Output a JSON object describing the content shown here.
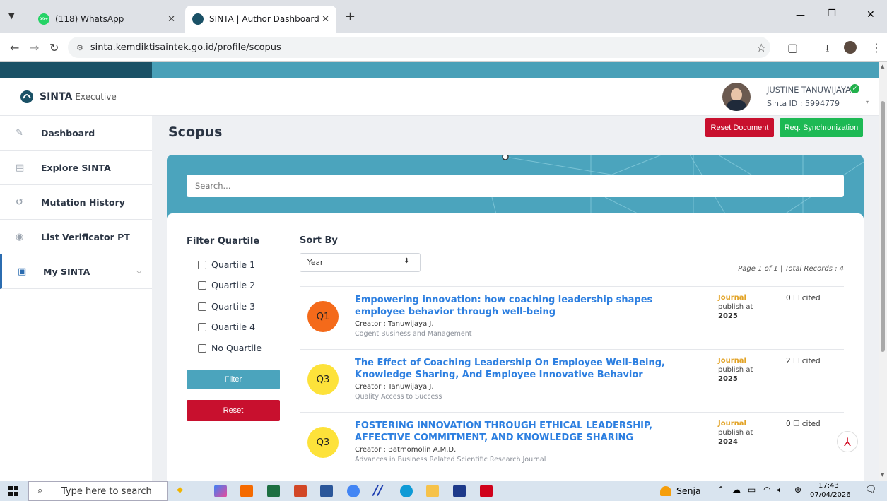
{
  "browser": {
    "tabs": [
      {
        "label": "(118) WhatsApp",
        "badge": "99+"
      },
      {
        "label": "SINTA | Author Dashboard"
      }
    ],
    "new_tab": "+",
    "url": "sinta.kemdiktisaintek.go.id/profile/scopus"
  },
  "sidebar": {
    "brand_name": "SINTA",
    "brand_sub": "Executive",
    "items": [
      {
        "label": "Dashboard",
        "icon": "pencil-icon"
      },
      {
        "label": "Explore SINTA",
        "icon": "document-icon"
      },
      {
        "label": "Mutation History",
        "icon": "history-icon"
      },
      {
        "label": "List Verificator PT",
        "icon": "user-circle-icon"
      },
      {
        "label": "My SINTA",
        "icon": "id-card-icon"
      }
    ]
  },
  "header": {
    "user_name": "JUSTINE TANUWIJAYA",
    "sinta_id": "Sinta ID : 5994779"
  },
  "page_title": "Scopus",
  "buttons": {
    "reset_document": "Reset Document",
    "req_sync": "Req. Synchronization",
    "filter": "Filter",
    "reset": "Reset"
  },
  "search": {
    "placeholder": "Search..."
  },
  "filter": {
    "title": "Filter Quartile",
    "options": [
      "Quartile 1",
      "Quartile 2",
      "Quartile 3",
      "Quartile 4",
      "No Quartile"
    ]
  },
  "sort": {
    "label": "Sort By",
    "selected": "Year"
  },
  "page_info": "Page 1 of 1 | Total Records : 4",
  "records": [
    {
      "quartile": "Q1",
      "color": "#f46a1a",
      "title": "Empowering innovation: how coaching leadership shapes employee behavior through well-being",
      "creator": "Creator : Tanuwijaya J.",
      "journal": "Cogent Business and Management",
      "type": "Journal",
      "publish_label": "publish at",
      "year": "2025",
      "cited": "0 ☐ cited"
    },
    {
      "quartile": "Q3",
      "color": "#fde23a",
      "title": "The Effect of Coaching Leadership On Employee Well-Being, Knowledge Sharing, And Employee Innovative Behavior",
      "creator": "Creator : Tanuwijaya J.",
      "journal": "Quality Access to Success",
      "type": "Journal",
      "publish_label": "publish at",
      "year": "2025",
      "cited": "2 ☐ cited"
    },
    {
      "quartile": "Q3",
      "color": "#fde23a",
      "title": "FOSTERING INNOVATION THROUGH ETHICAL LEADERSHIP, AFFECTIVE COMMITMENT, AND KNOWLEDGE SHARING",
      "creator": "Creator : Batmomolin A.M.D.",
      "journal": "Advances in Business Related Scientific Research Journal",
      "type": "Journal",
      "publish_label": "publish at",
      "year": "2024",
      "cited": "0 ☐ cited"
    }
  ],
  "taskbar": {
    "search_placeholder": "Type here to search",
    "weather": "Senja",
    "time": "17:43",
    "date": "07/04/2026"
  },
  "colors": {
    "accent_teal": "#49a0b8",
    "danger": "#c8102e",
    "success": "#1db954",
    "link": "#2d7fe0"
  }
}
